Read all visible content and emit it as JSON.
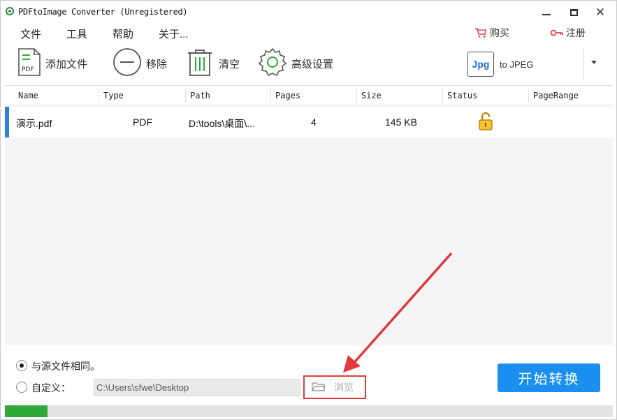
{
  "window": {
    "title": "PDFtoImage Converter (Unregistered)",
    "minimize": "—",
    "maximize": "□",
    "close": "✕"
  },
  "menu": {
    "items": [
      "文件",
      "工具",
      "帮助",
      "关于..."
    ],
    "buy": "购买",
    "register": "注册"
  },
  "toolbar": {
    "add": "添加文件",
    "remove": "移除",
    "clear": "清空",
    "settings": "高级设置",
    "format_icon": "Jpg",
    "format_label": "to JPEG"
  },
  "table": {
    "columns": [
      "Name",
      "Type",
      "Path",
      "Pages",
      "Size",
      "Status",
      "PageRange"
    ],
    "rows": [
      {
        "name": "演示.pdf",
        "type": "PDF",
        "path": "D:\\tools\\桌面\\...",
        "pages": "4",
        "size": "145 KB",
        "status": "lock-open-icon",
        "pagerange": ""
      }
    ]
  },
  "output": {
    "same_as_source": "与源文件相同。",
    "custom": "自定义：",
    "selected": "same_as_source",
    "path_value": "C:\\Users\\sfwe\\Desktop",
    "browse": "浏览"
  },
  "start_button": "开始转换",
  "progress": {
    "percent": 7
  },
  "colors": {
    "accent": "#1a8ff0",
    "progress": "#2faa3a",
    "annotation": "#e03a3a"
  }
}
